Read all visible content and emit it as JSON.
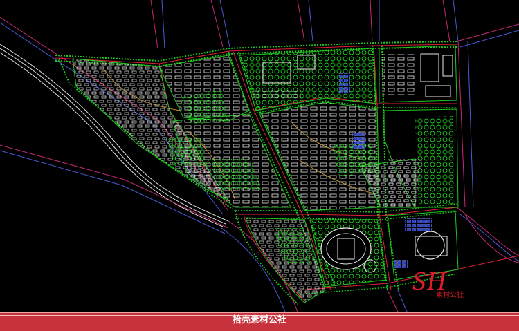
{
  "colors": {
    "background": "#000000",
    "road_outline_magenta": "#c8287a",
    "road_outline_blue": "#4a5ad8",
    "road_center_red": "#e0203a",
    "tree_green": "#1ec81e",
    "building_white": "#e8e8e8",
    "accent_blue": "#5a78e8",
    "railway_white": "#dddddd",
    "footer_red": "#c8323c",
    "watermark_red": "#d81e2a"
  },
  "watermark": {
    "letters": "SH",
    "subtitle": "素材公社"
  },
  "footer": {
    "caption": "拾壳素材公社"
  }
}
